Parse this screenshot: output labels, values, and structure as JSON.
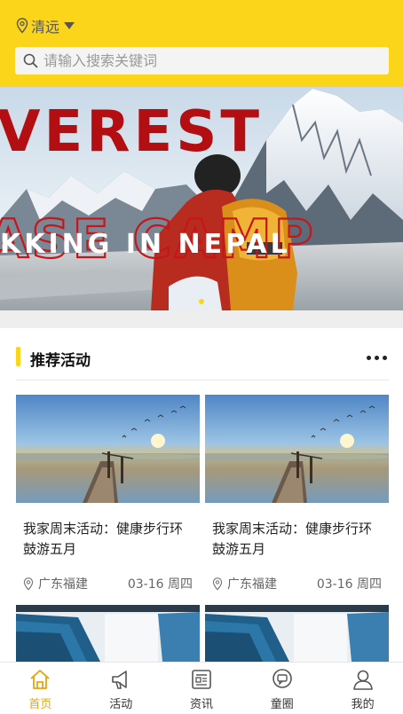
{
  "header": {
    "location": "清远",
    "search_placeholder": "请输入搜索关键词",
    "bg_color": "#fbd51a"
  },
  "banner": {
    "text_large": "VEREST",
    "text_outline": "ASE CAMP",
    "text_small": "KKING IN NEPAL",
    "slide_count": 1,
    "active_slide": 1
  },
  "section": {
    "title": "推荐活动",
    "more_icon": "more-dots-icon"
  },
  "activities": [
    {
      "title": "我家周末活动：健康步行环鼓游五月",
      "place": "广东福建",
      "date": "03-16 周四"
    },
    {
      "title": "我家周末活动：健康步行环鼓游五月",
      "place": "广东福建",
      "date": "03-16 周四"
    }
  ],
  "tabs": [
    {
      "label": "首页",
      "icon": "home-icon",
      "active": true
    },
    {
      "label": "活动",
      "icon": "megaphone-icon",
      "active": false
    },
    {
      "label": "资讯",
      "icon": "news-icon",
      "active": false
    },
    {
      "label": "童圈",
      "icon": "chat-circle-icon",
      "active": false
    },
    {
      "label": "我的",
      "icon": "user-icon",
      "active": false
    }
  ],
  "colors": {
    "accent": "#fbd51a",
    "active_tab": "#e5a50a",
    "banner_red": "#b30e12"
  }
}
